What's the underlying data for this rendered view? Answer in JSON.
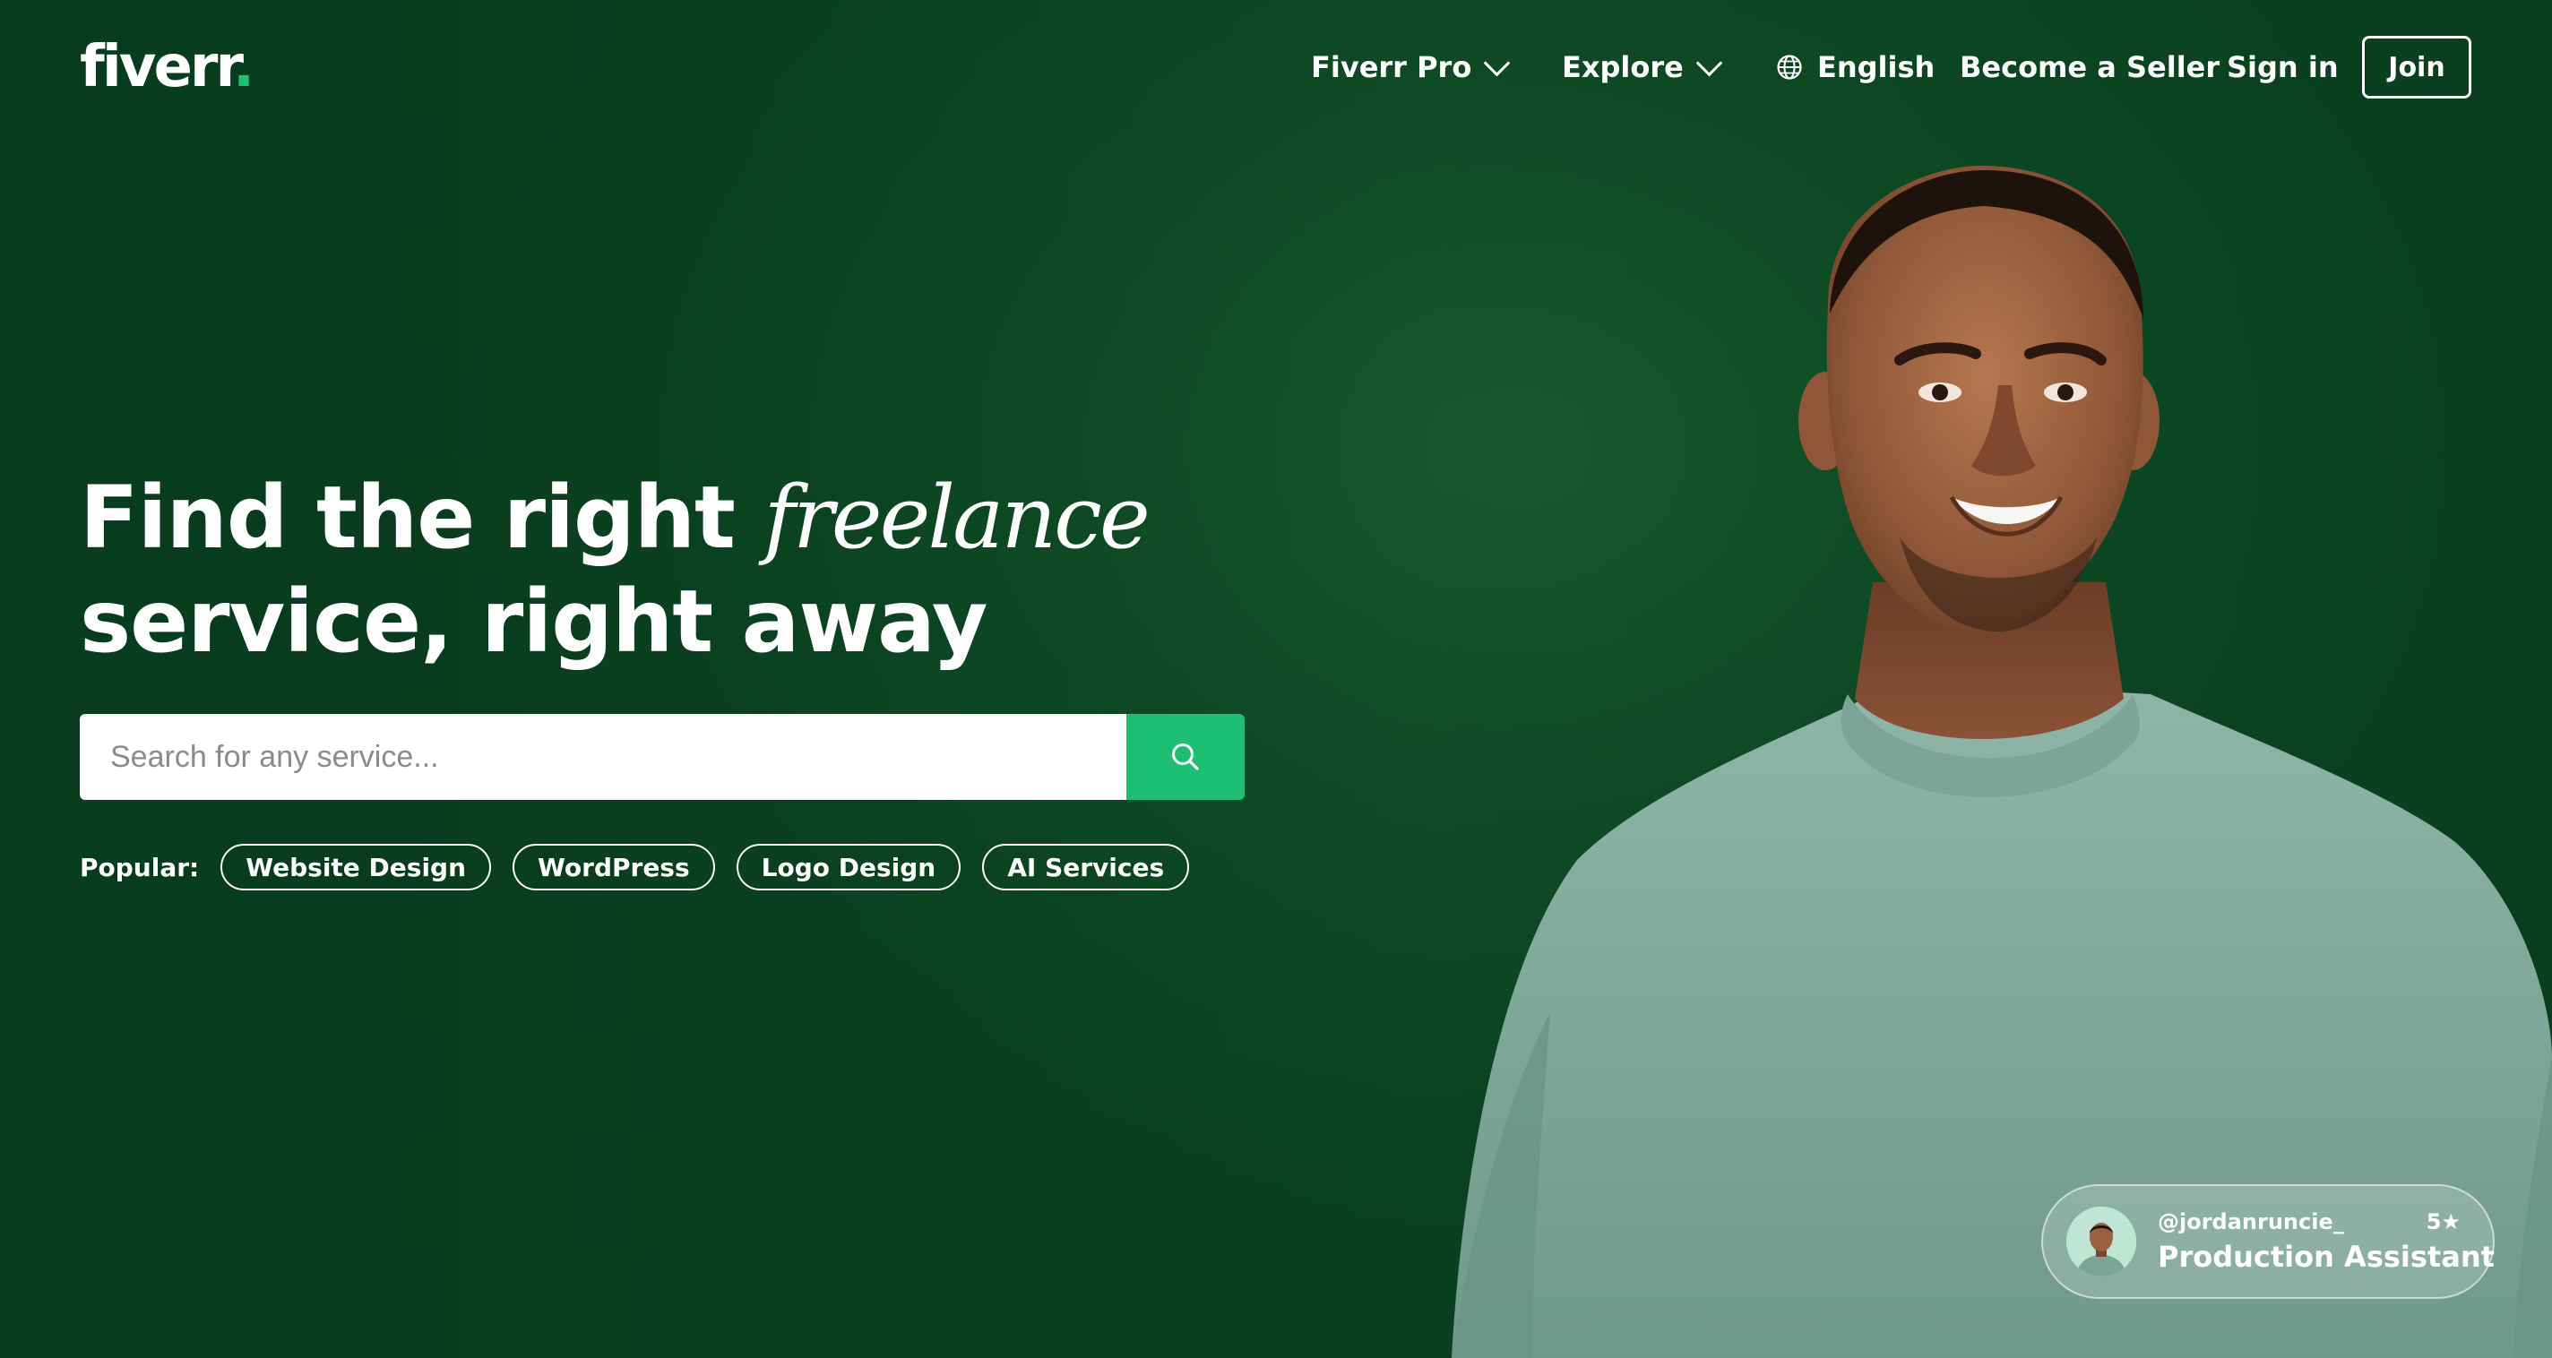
{
  "header": {
    "logo_text": "fiverr",
    "logo_dot": ".",
    "nav": {
      "fiverr_pro": "Fiverr Pro",
      "explore": "Explore",
      "language": "English",
      "become_seller": "Become a Seller",
      "sign_in": "Sign in",
      "join": "Join"
    }
  },
  "hero": {
    "headline_part1": "Find the right ",
    "headline_italic": "freelance",
    "headline_part2": "service, right away",
    "search_placeholder": "Search for any service...",
    "popular_label": "Popular:",
    "popular_tags": [
      "Website Design",
      "WordPress",
      "Logo Design",
      "AI Services"
    ]
  },
  "seller_card": {
    "handle": "@jordanruncie_",
    "rating": "5★",
    "role": "Production Assistant"
  },
  "colors": {
    "background": "#0e4a24",
    "accent": "#1dbf73",
    "text": "#ffffff"
  },
  "icons": [
    "chevron-down-icon",
    "globe-icon",
    "search-icon"
  ]
}
